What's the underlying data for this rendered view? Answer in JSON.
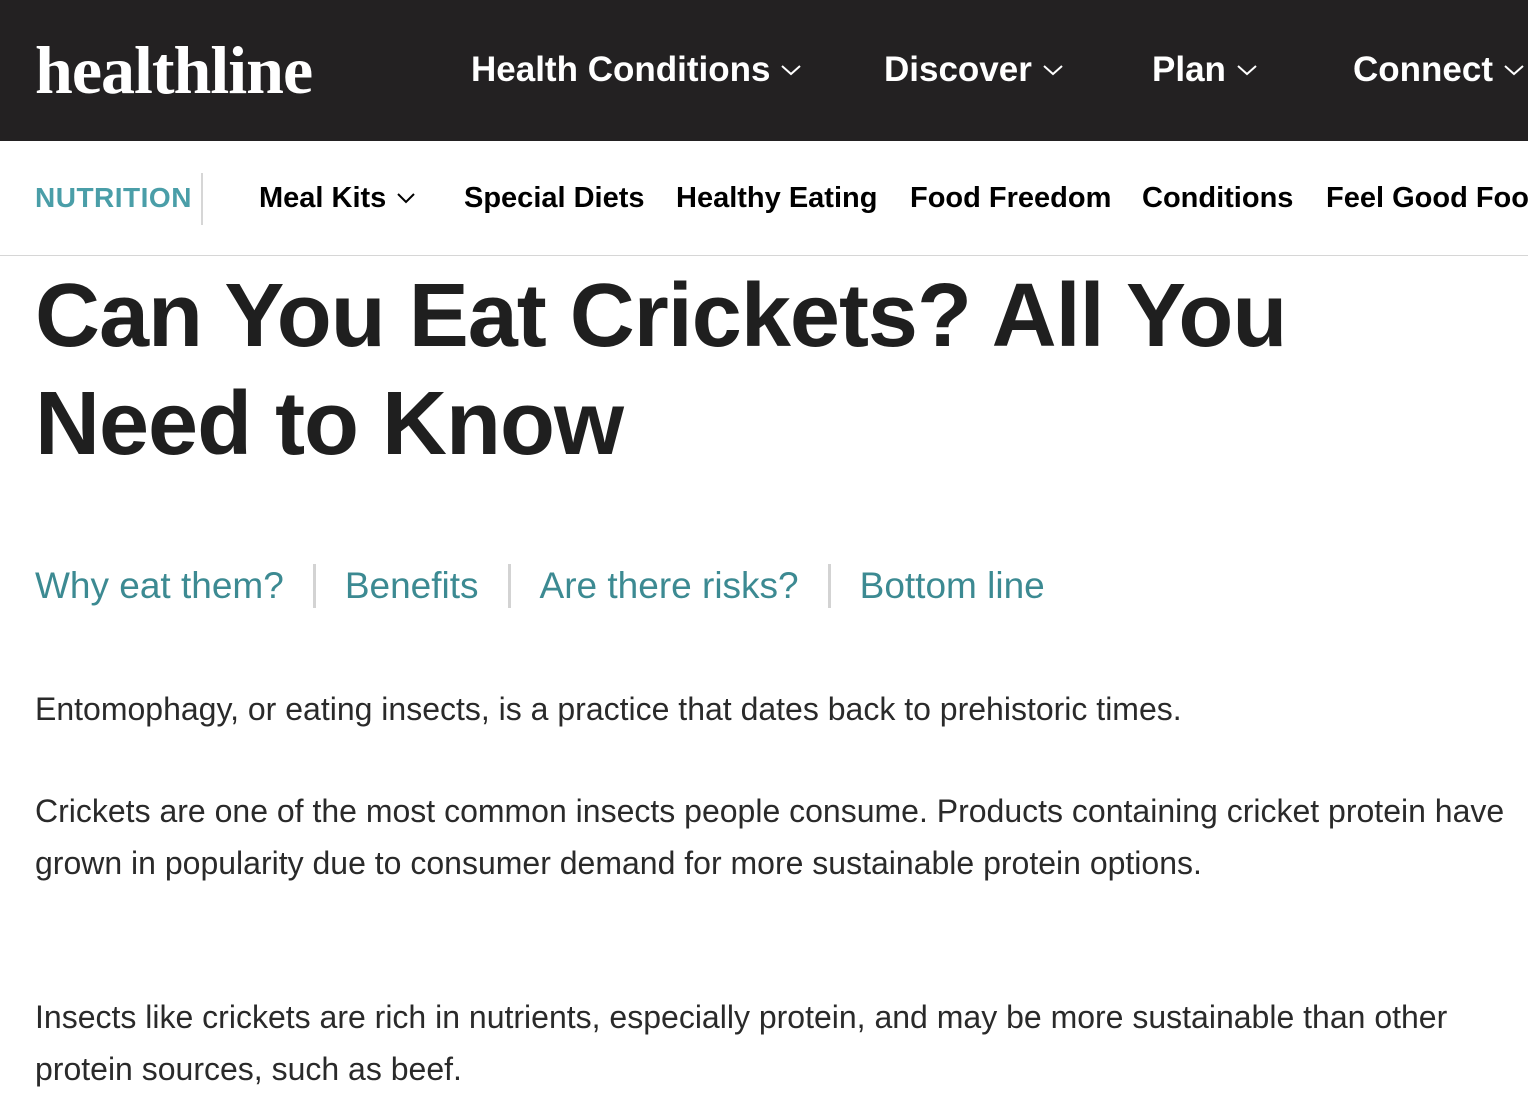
{
  "header": {
    "logo": "healthline",
    "nav": [
      {
        "label": "Health Conditions"
      },
      {
        "label": "Discover"
      },
      {
        "label": "Plan"
      },
      {
        "label": "Connect"
      }
    ]
  },
  "subnav": {
    "section": "NUTRITION",
    "items": [
      {
        "label": "Meal Kits"
      },
      {
        "label": "Special Diets"
      },
      {
        "label": "Healthy Eating"
      },
      {
        "label": "Food Freedom"
      },
      {
        "label": "Conditions"
      },
      {
        "label": "Feel Good Food"
      }
    ]
  },
  "article": {
    "title": "Can You Eat Crickets? All You Need to Know",
    "jump_links": [
      {
        "label": "Why eat them?"
      },
      {
        "label": "Benefits"
      },
      {
        "label": "Are there risks?"
      },
      {
        "label": "Bottom line"
      }
    ],
    "paragraphs": [
      "Entomophagy, or eating insects, is a practice that dates back to prehistoric times.",
      "Crickets are one of the most common insects people consume. Products containing cricket protein have grown in popularity due to consumer demand for more sustainable protein options.",
      "Insects like crickets are rich in nutrients, especially protein, and may be more sustainable than other protein sources, such as beef."
    ]
  },
  "colors": {
    "topbar_bg": "#232122",
    "accent_teal": "#4a9ea8",
    "link_teal": "#3c8a92"
  },
  "icons": {
    "dropdown": "chevron-down-icon"
  }
}
